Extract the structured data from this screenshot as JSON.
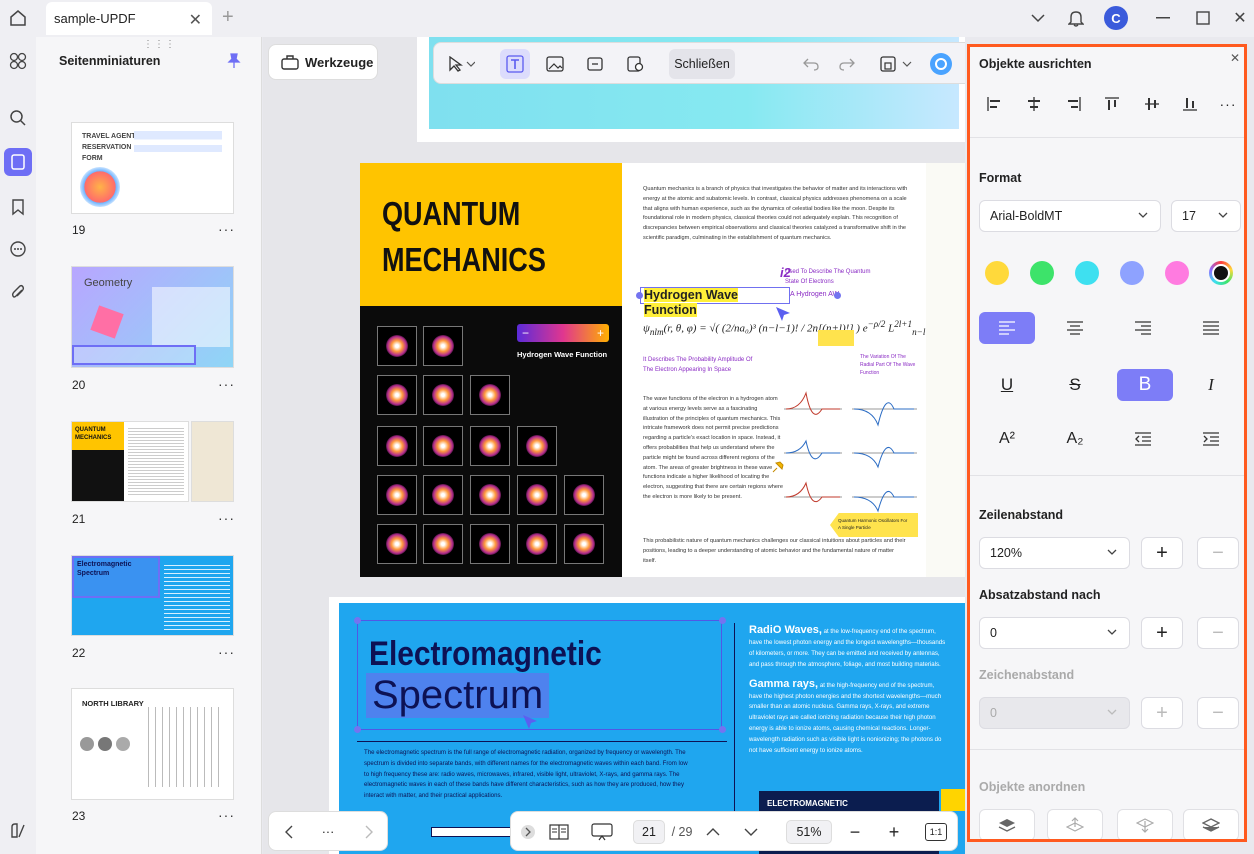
{
  "titlebar": {
    "tab_title": "sample-UPDF",
    "avatar_letter": "C"
  },
  "thumbnails": {
    "panel_title": "Seitenminiaturen",
    "pages": [
      {
        "num": "19",
        "label": "TRAVEL AGENT RESERVATION FORM"
      },
      {
        "num": "20",
        "label": "Geometry"
      },
      {
        "num": "21",
        "label": "QUANTUM MECHANICS"
      },
      {
        "num": "22",
        "label": "Electromagnetic Spectrum"
      },
      {
        "num": "23",
        "label": "NORTH LIBRARY"
      }
    ],
    "more": "···"
  },
  "toolbar": {
    "werkzeuge": "Werkzeuge",
    "close_label": "Schließen"
  },
  "document": {
    "qm": {
      "title_line1": "QUANTUM",
      "title_line2": "MECHANICS",
      "gradient_label": "Hydrogen Wave Function",
      "selected_text": "Hydrogen Wave Function",
      "intro": "Quantum mechanics is a branch of physics that investigates the behavior of matter and its interactions with energy at the atomic and subatomic levels. In contrast, classical physics addresses phenomena on a scale that aligns with human experience, such as the dynamics of celestial bodies like the moon. Despite its foundational role in modern physics, classical theories could not adequately explain. This recognition of discrepancies between empirical observations and classical theories catalyzed a transformative shift in the scientific paradigm, culminating in the establishment of quantum mechanics.",
      "annotation1": "Used To Describe The Quantum State Of Electrons",
      "annotation2": "A Hydrogen AW",
      "annotation3": "It Describes The Probability Amplitude Of The Electron Appearing In Space",
      "annotation4": "The Variation Of The Radial Part Of The Wave Function",
      "body": "The wave functions of the electron in a hydrogen atom at various energy levels serve as a fascinating illustration of the principles of quantum mechanics. This intricate framework does not permit precise predictions regarding a particle's exact location in space. Instead, it offers probabilities that help us understand where the particle might be found across different regions of the atom. The areas of greater brightness in these wave functions indicate a higher likelihood of locating the electron, suggesting that there are certain regions where the electron is more likely to be present.",
      "footer": "This probabilistic nature of quantum mechanics challenges our classical intuitions about particles and their positions, leading to a deeper understanding of atomic behavior and the fundamental nature of matter itself.",
      "callout": "Quantum Harmonic Oscillators For A Single Particle"
    },
    "em": {
      "title": "Electromagnetic",
      "subtitle": "Spectrum",
      "para": "The electromagnetic spectrum is the full range of electromagnetic radiation, organized by frequency or wavelength. The spectrum is divided into separate bands, with different names for the electromagnetic waves within each band. From low to high frequency these are: radio waves, microwaves, infrared, visible light, ultraviolet, X-rays, and gamma rays. The electromagnetic waves in each of these bands have different characteristics, such as how they are produced, how they interact with matter, and their practical applications.",
      "radio_head": "RadiO Waves,",
      "radio_text": "at the low-frequency end of the spectrum, have the lowest photon energy and the longest wavelengths—thousands of kilometers, or more. They can be emitted and received by antennas, and pass through the atmosphere, foliage, and most building materials.",
      "gamma_head": "Gamma rays,",
      "gamma_text": "at the high-frequency end of the spectrum, have the highest photon energies and the shortest wavelengths—much smaller than an atomic nucleus. Gamma rays, X-rays, and extreme ultraviolet rays are called ionizing radiation because their high photon energy is able to ionize atoms, causing chemical reactions. Longer-wavelength radiation such as visible light is nonionizing; the photons do not have sufficient energy to ionize atoms.",
      "box_title": "ELECTROMAGNETIC"
    }
  },
  "bottombar": {
    "current_page": "21",
    "total_pages": "/ 29",
    "zoom": "51%",
    "fit": "1:1",
    "more": "···"
  },
  "rightpanel": {
    "align_title": "Objekte ausrichten",
    "format_title": "Format",
    "font": "Arial-BoldMT",
    "font_size": "17",
    "line_spacing_title": "Zeilenabstand",
    "line_spacing": "120%",
    "para_spacing_title": "Absatzabstand nach",
    "para_spacing": "0",
    "char_spacing_title": "Zeichenabstand",
    "char_spacing": "0",
    "arrange_title": "Objekte anordnen",
    "superscript": "A²",
    "subscript": "A₂",
    "colors": [
      "#ffd93b",
      "#3de36a",
      "#3ee0f0",
      "#8ea2ff",
      "#ff7be0",
      "#111111"
    ],
    "accent": "#ff5a1f",
    "active_fill": "#7d7df7"
  }
}
